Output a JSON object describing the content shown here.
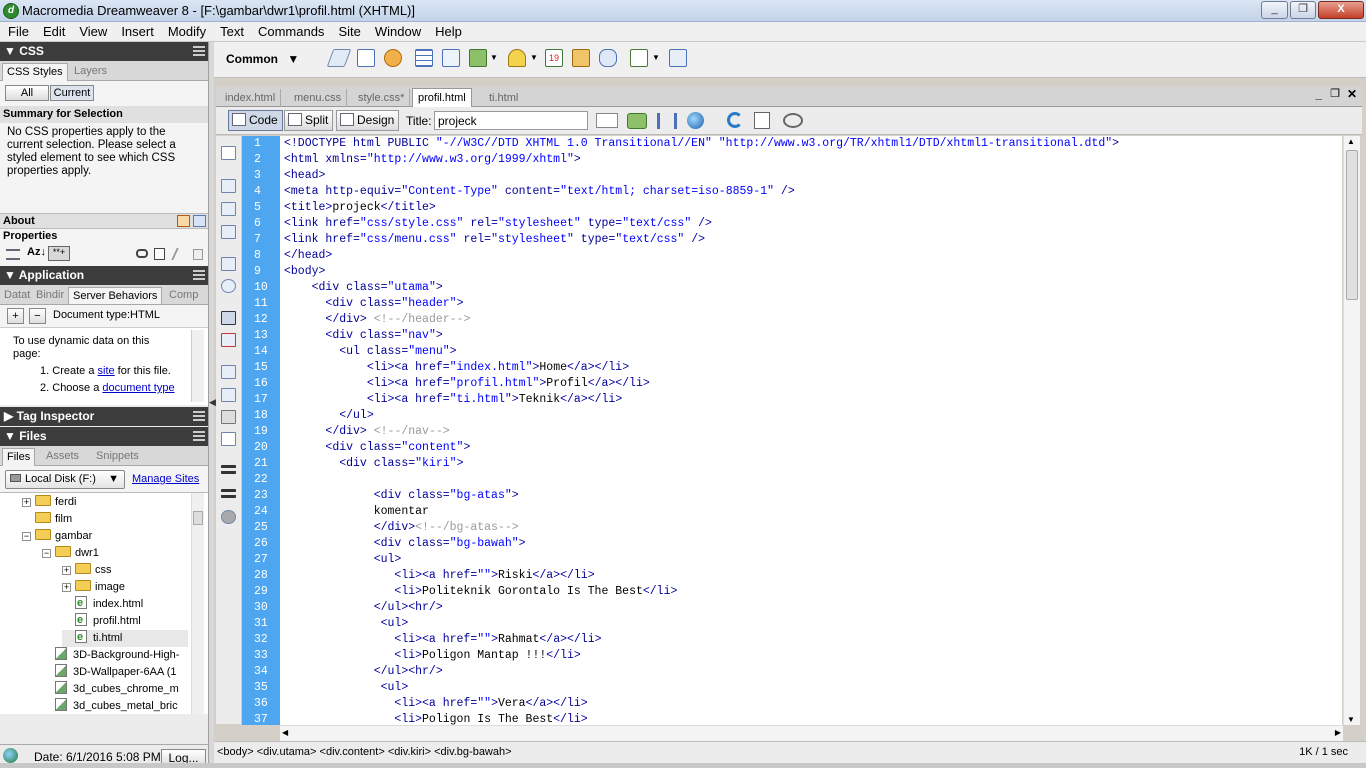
{
  "window": {
    "title": "Macromedia Dreamweaver 8 - [F:\\gambar\\dwr1\\profil.html (XHTML)]",
    "minimize": "_",
    "restore": "❐",
    "close": "X"
  },
  "menu": [
    "File",
    "Edit",
    "View",
    "Insert",
    "Modify",
    "Text",
    "Commands",
    "Site",
    "Window",
    "Help"
  ],
  "css_panel": {
    "header": "CSS",
    "tabs": [
      "CSS Styles",
      "Layers"
    ],
    "buttons": [
      "All",
      "Current"
    ],
    "summary_title": "Summary for Selection",
    "summary_text": "No CSS properties apply to the current selection.  Please select a styled element to see which CSS properties apply.",
    "about": "About",
    "properties": "Properties",
    "azicon": "Az↓",
    "star": "**+"
  },
  "application_panel": {
    "header": "Application",
    "tabs": [
      "Datat",
      "Bindir",
      "Server Behaviors",
      "Comp"
    ],
    "doc_type": "Document type:HTML",
    "intro": "To use dynamic data on this page:",
    "step1_num": "1.",
    "step1_pre": "Create a ",
    "step1_link": "site",
    "step1_post": " for this file.",
    "step2_num": "2.",
    "step2_pre": "Choose a ",
    "step2_link": "document type"
  },
  "tag_inspector": {
    "header": "Tag Inspector"
  },
  "files_panel": {
    "header": "Files",
    "tabs": [
      "Files",
      "Assets",
      "Snippets"
    ],
    "location": "Local Disk (F:)",
    "manage_sites": "Manage Sites",
    "tree": [
      {
        "name": "ferdi",
        "type": "folder",
        "exp": "+"
      },
      {
        "name": "film",
        "type": "folder",
        "exp": ""
      },
      {
        "name": "gambar",
        "type": "folder",
        "exp": "−"
      },
      {
        "name": "dwr1",
        "type": "folder",
        "exp": "−"
      },
      {
        "name": "css",
        "type": "folder",
        "exp": "+"
      },
      {
        "name": "image",
        "type": "folder",
        "exp": "+"
      },
      {
        "name": "index.html",
        "type": "html",
        "exp": ""
      },
      {
        "name": "profil.html",
        "type": "html",
        "exp": ""
      },
      {
        "name": "ti.html",
        "type": "html",
        "exp": ""
      },
      {
        "name": "3D-Background-High-",
        "type": "img",
        "exp": ""
      },
      {
        "name": "3D-Wallpaper-6AA (1",
        "type": "img",
        "exp": ""
      },
      {
        "name": "3d_cubes_chrome_m",
        "type": "img",
        "exp": ""
      },
      {
        "name": "3d_cubes_metal_bric",
        "type": "img",
        "exp": ""
      }
    ],
    "status_date": "Date: 6/1/2016 5:08 PM",
    "log_button": "Log..."
  },
  "insert_bar": {
    "category": "Common"
  },
  "doc_tabs": [
    "index.html",
    "menu.css",
    "style.css*",
    "profil.html",
    "ti.html"
  ],
  "doc_toolbar": {
    "code": "Code",
    "split": "Split",
    "design": "Design",
    "title_label": "Title:",
    "title_value": "projeck"
  },
  "code_lines": [
    [
      [
        "t",
        "<!DOCTYPE html PUBLIC "
      ],
      [
        "v",
        "\"-//W3C//DTD XHTML 1.0 Transitional//EN\" \"http://www.w3.org/TR/xhtml1/DTD/xhtml1-transitional.dtd\""
      ],
      [
        "t",
        ">"
      ]
    ],
    [
      [
        "t",
        "<html xmlns="
      ],
      [
        "v",
        "\"http://www.w3.org/1999/xhtml\""
      ],
      [
        "t",
        ">"
      ]
    ],
    [
      [
        "t",
        "<head>"
      ]
    ],
    [
      [
        "t",
        "<meta http-equiv="
      ],
      [
        "v",
        "\"Content-Type\""
      ],
      [
        "t",
        " content="
      ],
      [
        "v",
        "\"text/html; charset=iso-8859-1\""
      ],
      [
        "t",
        " />"
      ]
    ],
    [
      [
        "t",
        "<title>"
      ],
      [
        "x",
        "projeck"
      ],
      [
        "t",
        "</title>"
      ]
    ],
    [
      [
        "t",
        "<link href="
      ],
      [
        "v",
        "\"css/style.css\""
      ],
      [
        "t",
        " rel="
      ],
      [
        "v",
        "\"stylesheet\""
      ],
      [
        "t",
        " type="
      ],
      [
        "v",
        "\"text/css\""
      ],
      [
        "t",
        " />"
      ]
    ],
    [
      [
        "t",
        "<link href="
      ],
      [
        "v",
        "\"css/menu.css\""
      ],
      [
        "t",
        " rel="
      ],
      [
        "v",
        "\"stylesheet\""
      ],
      [
        "t",
        " type="
      ],
      [
        "v",
        "\"text/css\""
      ],
      [
        "t",
        " />"
      ]
    ],
    [
      [
        "t",
        "</head>"
      ]
    ],
    [
      [
        "t",
        "<body>"
      ]
    ],
    [
      [
        "x",
        "    "
      ],
      [
        "t",
        "<div class="
      ],
      [
        "v",
        "\"utama\""
      ],
      [
        "t",
        ">"
      ]
    ],
    [
      [
        "x",
        "      "
      ],
      [
        "t",
        "<div class="
      ],
      [
        "v",
        "\"header\""
      ],
      [
        "t",
        ">"
      ]
    ],
    [
      [
        "x",
        "      "
      ],
      [
        "t",
        "</div>"
      ],
      [
        "c",
        " <!--/header-->"
      ]
    ],
    [
      [
        "x",
        "      "
      ],
      [
        "t",
        "<div class="
      ],
      [
        "v",
        "\"nav\""
      ],
      [
        "t",
        ">"
      ]
    ],
    [
      [
        "x",
        "        "
      ],
      [
        "t",
        "<ul class="
      ],
      [
        "v",
        "\"menu\""
      ],
      [
        "t",
        ">"
      ]
    ],
    [
      [
        "x",
        "            "
      ],
      [
        "t",
        "<li><a href="
      ],
      [
        "v",
        "\"index.html\""
      ],
      [
        "t",
        ">"
      ],
      [
        "x",
        "Home"
      ],
      [
        "t",
        "</a></li>"
      ]
    ],
    [
      [
        "x",
        "            "
      ],
      [
        "t",
        "<li><a href="
      ],
      [
        "v",
        "\"profil.html\""
      ],
      [
        "t",
        ">"
      ],
      [
        "x",
        "Profil"
      ],
      [
        "t",
        "</a></li>"
      ]
    ],
    [
      [
        "x",
        "            "
      ],
      [
        "t",
        "<li><a href="
      ],
      [
        "v",
        "\"ti.html\""
      ],
      [
        "t",
        ">"
      ],
      [
        "x",
        "Teknik"
      ],
      [
        "t",
        "</a></li>"
      ]
    ],
    [
      [
        "x",
        "        "
      ],
      [
        "t",
        "</ul>"
      ]
    ],
    [
      [
        "x",
        "      "
      ],
      [
        "t",
        "</div>"
      ],
      [
        "c",
        " <!--/nav-->"
      ]
    ],
    [
      [
        "x",
        "      "
      ],
      [
        "t",
        "<div class="
      ],
      [
        "v",
        "\"content\""
      ],
      [
        "t",
        ">"
      ]
    ],
    [
      [
        "x",
        "        "
      ],
      [
        "t",
        "<div class="
      ],
      [
        "v",
        "\"kiri\""
      ],
      [
        "t",
        ">"
      ]
    ],
    [
      [
        "x",
        ""
      ]
    ],
    [
      [
        "x",
        "             "
      ],
      [
        "t",
        "<div class="
      ],
      [
        "v",
        "\"bg-atas\""
      ],
      [
        "t",
        ">"
      ]
    ],
    [
      [
        "x",
        "             komentar"
      ]
    ],
    [
      [
        "x",
        "             "
      ],
      [
        "t",
        "</div>"
      ],
      [
        "c",
        "<!--/bg-atas-->"
      ]
    ],
    [
      [
        "x",
        "             "
      ],
      [
        "t",
        "<div class="
      ],
      [
        "v",
        "\"bg-bawah\""
      ],
      [
        "t",
        ">"
      ]
    ],
    [
      [
        "x",
        "             "
      ],
      [
        "t",
        "<ul>"
      ]
    ],
    [
      [
        "x",
        "                "
      ],
      [
        "t",
        "<li><a href="
      ],
      [
        "v",
        "\"\""
      ],
      [
        "t",
        ">"
      ],
      [
        "x",
        "Riski"
      ],
      [
        "t",
        "</a></li>"
      ]
    ],
    [
      [
        "x",
        "                "
      ],
      [
        "t",
        "<li>"
      ],
      [
        "x",
        "Politeknik Gorontalo Is The Best"
      ],
      [
        "t",
        "</li>"
      ]
    ],
    [
      [
        "x",
        "             "
      ],
      [
        "t",
        "</ul><hr/>"
      ]
    ],
    [
      [
        "x",
        "              "
      ],
      [
        "t",
        "<ul>"
      ]
    ],
    [
      [
        "x",
        "                "
      ],
      [
        "t",
        "<li><a href="
      ],
      [
        "v",
        "\"\""
      ],
      [
        "t",
        ">"
      ],
      [
        "x",
        "Rahmat"
      ],
      [
        "t",
        "</a></li>"
      ]
    ],
    [
      [
        "x",
        "                "
      ],
      [
        "t",
        "<li>"
      ],
      [
        "x",
        "Poligon Mantap !!!"
      ],
      [
        "t",
        "</li>"
      ]
    ],
    [
      [
        "x",
        "             "
      ],
      [
        "t",
        "</ul><hr/>"
      ]
    ],
    [
      [
        "x",
        "              "
      ],
      [
        "t",
        "<ul>"
      ]
    ],
    [
      [
        "x",
        "                "
      ],
      [
        "t",
        "<li><a href="
      ],
      [
        "v",
        "\"\""
      ],
      [
        "t",
        ">"
      ],
      [
        "x",
        "Vera"
      ],
      [
        "t",
        "</a></li>"
      ]
    ],
    [
      [
        "x",
        "                "
      ],
      [
        "t",
        "<li>"
      ],
      [
        "x",
        "Poligon Is The Best"
      ],
      [
        "t",
        "</li>"
      ]
    ]
  ],
  "status_bar": {
    "tag_selector": "<body> <div.utama> <div.content> <div.kiri> <div.bg-bawah>",
    "size": "1K / 1 sec"
  }
}
